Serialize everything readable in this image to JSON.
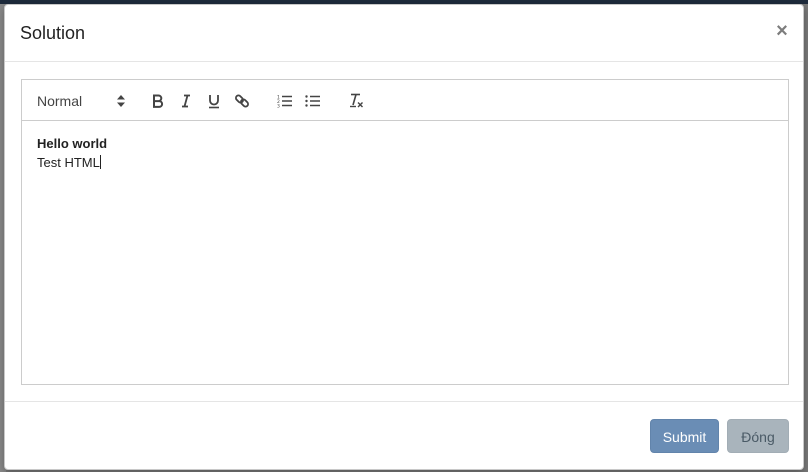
{
  "modal": {
    "title": "Solution",
    "close_symbol": "×"
  },
  "toolbar": {
    "format_value": "Normal",
    "buttons": [
      {
        "name": "bold-icon"
      },
      {
        "name": "italic-icon"
      },
      {
        "name": "underline-icon"
      },
      {
        "name": "link-icon"
      },
      {
        "name": "ordered-list-icon"
      },
      {
        "name": "bullet-list-icon"
      },
      {
        "name": "clear-format-icon"
      }
    ]
  },
  "editor": {
    "line1": "Hello world",
    "line2": "Test HTML"
  },
  "footer": {
    "submit_label": "Submit",
    "close_label": "Đóng"
  },
  "colors": {
    "submit_bg": "#6a8db5",
    "close_bg": "#a9b4bc"
  }
}
